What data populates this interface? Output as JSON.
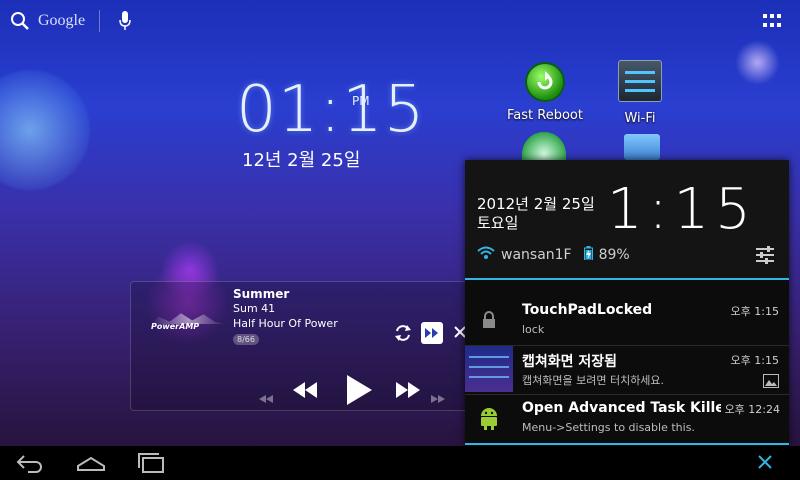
{
  "search": {
    "engine_label": "Google",
    "icon": "search-icon",
    "voice_icon": "microphone-icon"
  },
  "launcher": {
    "apps_icon": "all-apps-grid-icon"
  },
  "clock_widget": {
    "time": "01:15",
    "ampm": "PM",
    "date": "12년 2월 25일"
  },
  "desktop_apps": [
    {
      "label": "Fast Reboot",
      "icon": "fast-reboot-icon"
    },
    {
      "label": "Wi-Fi",
      "icon": "wifi-settings-icon"
    }
  ],
  "music_widget": {
    "logo": "PowerAMP",
    "title": "Summer",
    "album": "Sum 41",
    "playlist": "Half Hour Of Power",
    "track_counter": "8/66"
  },
  "notification_panel": {
    "date_line1": "2012년 2월 25일",
    "date_line2": "토요일",
    "time": "1:15",
    "network_name": "wansan1F",
    "battery": "89%",
    "accent_color": "#33b5e5",
    "notifications": [
      {
        "title": "TouchPadLocked",
        "text": "lock",
        "time": "오후 1:15",
        "icon": "lock-icon"
      },
      {
        "title": "캡쳐화면 저장됨",
        "text": "캡쳐화면을 보려면 터치하세요.",
        "time": "오후 1:15",
        "icon": "screenshot-thumbnail"
      },
      {
        "title": "Open Advanced Task Killer",
        "text": "Menu->Settings to disable this.",
        "time": "오후 12:24",
        "icon": "android-icon"
      }
    ]
  },
  "navbar": {
    "back": "back-icon",
    "home": "home-icon",
    "recents": "recent-apps-icon",
    "close": "close-icon"
  }
}
